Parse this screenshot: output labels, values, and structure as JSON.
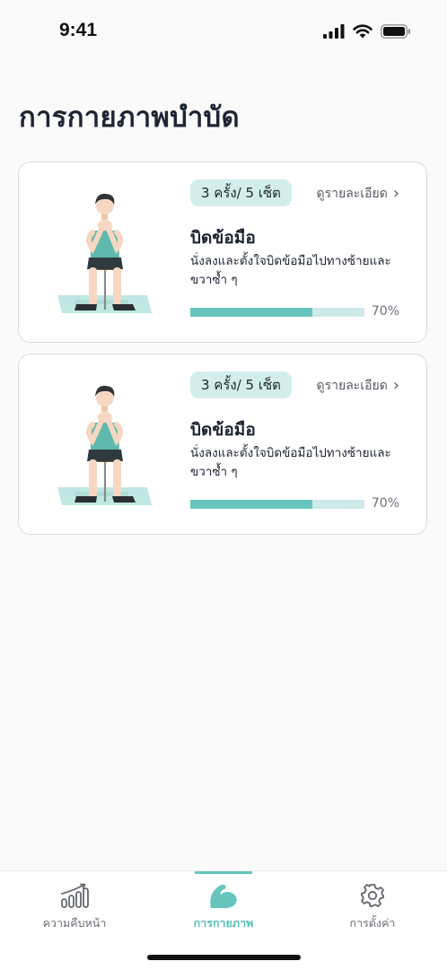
{
  "status_bar": {
    "time": "9:41"
  },
  "page": {
    "title": "การกายภาพบำบัด"
  },
  "exercises": [
    {
      "badge": "3 ครั้ง/ 5 เซ็ต",
      "detail_link": "ดูรายละเอียด",
      "title": "บิดข้อมือ",
      "description": "นั่งลงและตั้งใจบิดข้อมือไปทางซ้ายและขวาซ้ำ ๆ",
      "progress": 70,
      "progress_label": "70%"
    },
    {
      "badge": "3 ครั้ง/ 5 เซ็ต",
      "detail_link": "ดูรายละเอียด",
      "title": "บิดข้อมือ",
      "description": "นั่งลงและตั้งใจบิดข้อมือไปทางซ้ายและขวาซ้ำ ๆ",
      "progress": 70,
      "progress_label": "70%"
    }
  ],
  "bottom_nav": {
    "items": [
      {
        "label": "ความคืบหน้า",
        "icon": "progress-chart-icon",
        "active": false
      },
      {
        "label": "การกายภาพ",
        "icon": "flexed-arm-icon",
        "active": true
      },
      {
        "label": "การตั้งค่า",
        "icon": "gear-icon",
        "active": false
      }
    ]
  },
  "colors": {
    "accent": "#66c5bd",
    "badge_bg": "#d3eeea",
    "track": "#cdeae6",
    "text_dark": "#1e2433"
  }
}
